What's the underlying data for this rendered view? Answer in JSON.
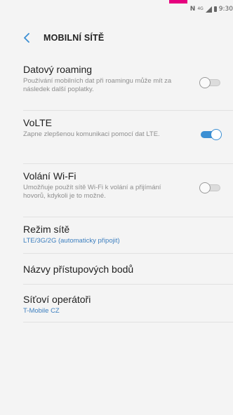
{
  "status_bar": {
    "nfc": "N",
    "network": "4G",
    "time": "9:30"
  },
  "header": {
    "title": "MOBILNÍ SÍTĚ"
  },
  "settings": {
    "roaming": {
      "title": "Datový roaming",
      "description": "Používání mobilních dat při roamingu může mít za následek další poplatky.",
      "enabled": false
    },
    "volte": {
      "title": "VoLTE",
      "description": "Zapne zlepšenou komunikaci pomocí dat LTE.",
      "enabled": true
    },
    "wifi_calling": {
      "title": "Volání Wi-Fi",
      "description": "Umožňuje použít sítě Wi-Fi k volání a přijímání hovorů, kdykoli je to možné.",
      "enabled": false
    },
    "network_mode": {
      "title": "Režim sítě",
      "value": "LTE/3G/2G (automaticky připojit)"
    },
    "apn": {
      "title": "Názvy přístupových bodů"
    },
    "operators": {
      "title": "Síťoví operátoři",
      "value": "T-Mobile CZ"
    }
  },
  "colors": {
    "accent": "#3b8fd3",
    "link_value": "#3d7fbf",
    "background": "#f4f4f4",
    "brand_notch": "#e6007e"
  },
  "icons": {
    "back": "chevron-left-icon",
    "signal": "signal-icon",
    "battery": "battery-icon"
  }
}
